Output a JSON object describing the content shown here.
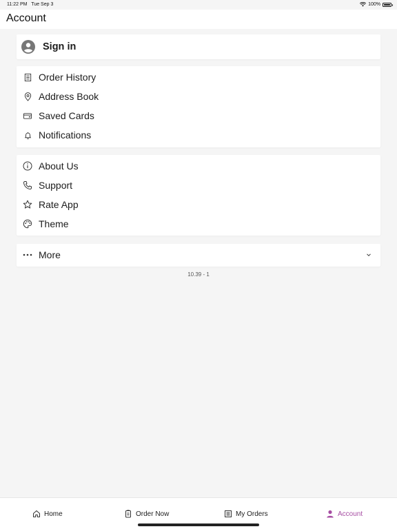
{
  "status_bar": {
    "time": "11:22 PM",
    "date": "Tue Sep 3",
    "battery": "100%"
  },
  "header": {
    "title": "Account"
  },
  "signin": {
    "label": "Sign in"
  },
  "menu_group1": [
    {
      "label": "Order History",
      "icon": "receipt-icon"
    },
    {
      "label": "Address Book",
      "icon": "location-pin-icon"
    },
    {
      "label": "Saved Cards",
      "icon": "credit-card-icon"
    },
    {
      "label": "Notifications",
      "icon": "bell-icon"
    }
  ],
  "menu_group2": [
    {
      "label": "About Us",
      "icon": "info-icon"
    },
    {
      "label": "Support",
      "icon": "phone-icon"
    },
    {
      "label": "Rate App",
      "icon": "star-icon"
    },
    {
      "label": "Theme",
      "icon": "palette-icon"
    }
  ],
  "more": {
    "label": "More"
  },
  "version": "10.39 - 1",
  "tabbar": {
    "tabs": [
      {
        "label": "Home",
        "icon": "home-icon"
      },
      {
        "label": "Order Now",
        "icon": "menu-clipboard-icon"
      },
      {
        "label": "My Orders",
        "icon": "orders-list-icon"
      },
      {
        "label": "Account",
        "icon": "person-icon",
        "active": true
      }
    ]
  },
  "colors": {
    "accent": "#a64ea3",
    "background": "#f5f5f5",
    "card": "#ffffff"
  }
}
